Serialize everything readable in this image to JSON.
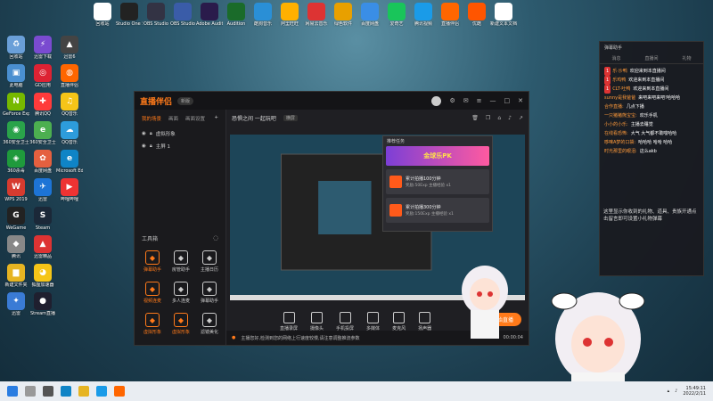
{
  "desktop": {
    "icons_col1": [
      {
        "label": "回收站",
        "color": "#6a9fd8",
        "glyph": "♻"
      },
      {
        "label": "此电脑",
        "color": "#4a8fd0",
        "glyph": "▣"
      },
      {
        "label": "GeForce Experience",
        "color": "#76b900",
        "glyph": "N"
      },
      {
        "label": "360安全卫士",
        "color": "#2aa34a",
        "glyph": "◉"
      },
      {
        "label": "360杀毒",
        "color": "#1f9a3c",
        "glyph": "◈"
      },
      {
        "label": "WPS 2019",
        "color": "#d63b2f",
        "glyph": "W"
      },
      {
        "label": "WeGame",
        "color": "#222",
        "glyph": "G"
      },
      {
        "label": "腾讯",
        "color": "#888",
        "glyph": "◆"
      },
      {
        "label": "新建文件夹",
        "color": "#e6b422",
        "glyph": "▆"
      },
      {
        "label": "迅雷",
        "color": "#3a7bd5",
        "glyph": "✦"
      }
    ],
    "icons_col2": [
      {
        "label": "迅雷下载",
        "color": "#7a4bd0",
        "glyph": "⚡"
      },
      {
        "label": "GD应用",
        "color": "#d23",
        "glyph": "◎"
      },
      {
        "label": "腾讯QQ",
        "color": "#ff3b3b",
        "glyph": "✚"
      },
      {
        "label": "360安全卫士",
        "color": "#4caf50",
        "glyph": "e"
      },
      {
        "label": "百度网盘",
        "color": "#e5603f",
        "glyph": "✿"
      },
      {
        "label": "迅雷",
        "color": "#1d74d6",
        "glyph": "✈"
      },
      {
        "label": "Steam",
        "color": "#1b2838",
        "glyph": "S"
      },
      {
        "label": "迅雷精品",
        "color": "#d33",
        "glyph": "▲"
      },
      {
        "label": "狐狸加速器",
        "color": "#f5c518",
        "glyph": "◕"
      },
      {
        "label": "Stream直播",
        "color": "#1f1f2f",
        "glyph": "●"
      }
    ],
    "icons_col3": [
      {
        "label": "迅雷6",
        "color": "#444",
        "glyph": "▲"
      },
      {
        "label": "直播伴侣",
        "color": "#f60",
        "glyph": "◍"
      },
      {
        "label": "QQ音乐",
        "color": "#f5c518",
        "glyph": "♫"
      },
      {
        "label": "QQ音乐",
        "color": "#2d9cdb",
        "glyph": "☁"
      },
      {
        "label": "Microsoft Edge",
        "color": "#0f84c6",
        "glyph": "e"
      },
      {
        "label": "哔哩哔哩",
        "color": "#e33",
        "glyph": "▶"
      }
    ],
    "top_icons": [
      {
        "label": "回收站",
        "color": "#fff"
      },
      {
        "label": "Studio One 5",
        "color": "#222"
      },
      {
        "label": "OBS Studio",
        "color": "#334"
      },
      {
        "label": "OBS Studio",
        "color": "#3a5ca8"
      },
      {
        "label": "Adobe Audition",
        "color": "#2a1b4b"
      },
      {
        "label": "Audition",
        "color": "#1a6b2a"
      },
      {
        "label": "酷狗音乐",
        "color": "#2a8fd6"
      },
      {
        "label": "阿里旺旺",
        "color": "#ffb000"
      },
      {
        "label": "网易云音乐",
        "color": "#d33"
      },
      {
        "label": "绿色软件",
        "color": "#e8a000"
      },
      {
        "label": "百度网盘",
        "color": "#3a8ee6"
      },
      {
        "label": "爱奇艺",
        "color": "#19c55a"
      },
      {
        "label": "腾讯视频",
        "color": "#1a9be8"
      },
      {
        "label": "直播伴侣",
        "color": "#f60"
      },
      {
        "label": "优酷",
        "color": "#ff5500"
      },
      {
        "label": "新建文本文档",
        "color": "#fff"
      }
    ]
  },
  "window": {
    "app_name": "直播伴侣",
    "version": "新版",
    "left_tabs": [
      "我的场景",
      "画面",
      "画面设置"
    ],
    "scenes": [
      "虚拟形象",
      "主屏 1"
    ],
    "toolbox_title": "工具箱",
    "tools": [
      {
        "label": "弹幕助手",
        "color": "#ff7a1a"
      },
      {
        "label": "房管助手",
        "color": "#ccc"
      },
      {
        "label": "主播日历",
        "color": "#ccc"
      },
      {
        "label": "视频连麦",
        "color": "#ff7a1a"
      },
      {
        "label": "多人连麦",
        "color": "#ccc"
      },
      {
        "label": "弹幕助手",
        "color": "#ccc"
      },
      {
        "label": "虚拟形象",
        "color": "#ff7a1a"
      },
      {
        "label": "虚拟形象",
        "color": "#ff7a1a"
      },
      {
        "label": "滤镜美化",
        "color": "#ccc"
      }
    ],
    "scene_title": "恐惧之间 一起玩吧",
    "scene_tag": "横屏",
    "bottom_buttons": [
      "直播录屏",
      "摄像头",
      "手机投屏",
      "多媒体",
      "麦克风",
      "扬声器"
    ],
    "start_button": "开始直播",
    "status_text": "主播您好,检测到您的网络上行速度较慢,请注意调整推流参数",
    "status_time_left": "00:00:00",
    "status_time_right": "00:00:04"
  },
  "popup": {
    "header": "推荐任务",
    "banner": "金球乐PK",
    "cards": [
      {
        "title": "累计拍播100分钟",
        "sub": "奖励:50Exp 主播经验 x1"
      },
      {
        "title": "累计拍播300分钟",
        "sub": "奖励:150Exp 主播经验 x1"
      }
    ]
  },
  "chat": {
    "header": "弹幕助手",
    "tabs": [
      "消息",
      "直播间",
      "礼物"
    ],
    "messages": [
      {
        "user": "乐·沙鸭",
        "text": "欢迎来到本直播间",
        "badge": "1"
      },
      {
        "user": "乐鸡鸭",
        "text": "欢迎来到本直播间",
        "badge": "1"
      },
      {
        "user": "CLT·吐鸭",
        "text": "欢迎来到本直播间",
        "badge": "1"
      },
      {
        "user": "sunny是我爸爸",
        "text": "来吧来吧来吧!哈哈哈",
        "badge": ""
      },
      {
        "user": "合作直播:",
        "text": "几点下播",
        "badge": ""
      },
      {
        "user": "一只猪猪熊宝宝:",
        "text": "欢乐手机",
        "badge": ""
      },
      {
        "user": "小小的小乐:",
        "text": "主播去睡觉",
        "badge": ""
      },
      {
        "user": "在线看恐怖:",
        "text": "大气 大气都不敢喘哈哈",
        "badge": ""
      },
      {
        "user": "哆唻A梦的口袋:",
        "text": "哈哈哈 哈哈 哈哈",
        "badge": ""
      },
      {
        "user": "时光那里的眼泪:",
        "text": "这么akb",
        "badge": ""
      }
    ],
    "tip": "这里显示你收到的礼物、道具、贵族开通点击留言即可设置小礼物弹幕"
  },
  "taskbar": {
    "time": "15:49:11",
    "date": "2022/2/11"
  }
}
